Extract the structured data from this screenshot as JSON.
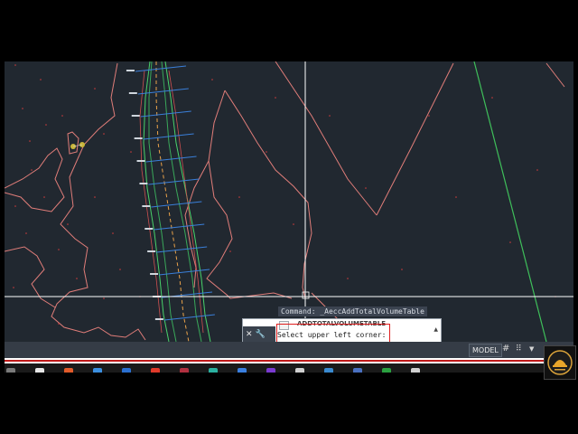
{
  "command_line": {
    "history": "Command: _AeccAddTotalVolumeTable",
    "autocomplete": "ADDTOTALVOLUMETABLE",
    "prompt": "Select upper left corner:",
    "close_glyph": "✕",
    "settings_glyph": "🔧",
    "dropdown_glyph": "▲"
  },
  "status_bar": {
    "model_tab": "MODEL",
    "grid_glyph": "#",
    "snap_glyph": "⠿",
    "menu_glyph": "▼"
  },
  "colors": {
    "canvas_background": "#212830",
    "contour": "#e07d79",
    "alignment": "#49d26a",
    "sections": "#3a7fd9",
    "crosshair": "#ffffff",
    "highlight": "#e02020"
  },
  "icons": [
    "close-icon",
    "wrench-icon",
    "autocomplete-command-icon",
    "grid-icon",
    "snap-mode-icon",
    "chevron-down-icon",
    "channel-logo-icon"
  ]
}
